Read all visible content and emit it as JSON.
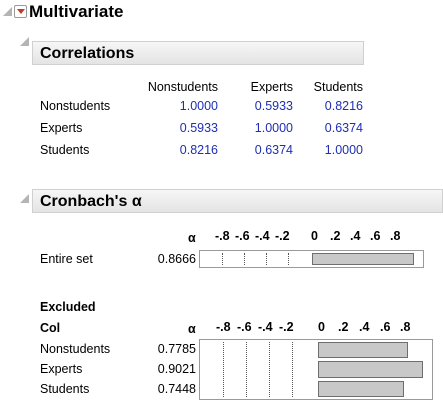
{
  "multivariate": {
    "title": "Multivariate"
  },
  "correlations": {
    "title": "Correlations",
    "columns": [
      "Nonstudents",
      "Experts",
      "Students"
    ],
    "rows": [
      {
        "label": "Nonstudents",
        "values": [
          "1.0000",
          "0.5933",
          "0.8216"
        ]
      },
      {
        "label": "Experts",
        "values": [
          "0.5933",
          "1.0000",
          "0.6374"
        ]
      },
      {
        "label": "Students",
        "values": [
          "0.8216",
          "0.6374",
          "1.0000"
        ]
      }
    ]
  },
  "cronbach": {
    "title": "Cronbach's α",
    "alpha_header": "α",
    "axis_ticks": [
      "-.8",
      "-.6",
      "-.4",
      "-.2",
      "0",
      ".2",
      ".4",
      ".6",
      ".8"
    ],
    "entire": {
      "label": "Entire set",
      "alpha": "0.8666",
      "alpha_value": 0.8666
    },
    "excluded_header_1": "Excluded",
    "excluded_header_2": "Col",
    "excluded": [
      {
        "label": "Nonstudents",
        "alpha": "0.7785",
        "alpha_value": 0.7785
      },
      {
        "label": "Experts",
        "alpha": "0.9021",
        "alpha_value": 0.9021
      },
      {
        "label": "Students",
        "alpha": "0.7448",
        "alpha_value": 0.7448
      }
    ]
  }
}
